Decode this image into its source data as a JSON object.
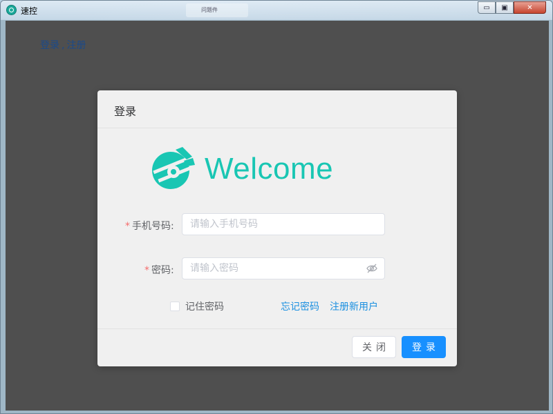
{
  "window": {
    "title": "速控",
    "background_tab_label": "问题件",
    "controls": {
      "minimize": "▭",
      "maximize": "▣",
      "close": "✕"
    }
  },
  "top_links": {
    "login": "登录",
    "separator": ",",
    "register": "注册"
  },
  "dialog": {
    "title": "登录",
    "welcome_text": "Welcome",
    "phone": {
      "label": "手机号码:",
      "placeholder": "请输入手机号码",
      "value": ""
    },
    "password": {
      "label": "密码:",
      "placeholder": "请输入密码",
      "value": ""
    },
    "required_mark": "*",
    "remember_label": "记住密码",
    "remember_checked": false,
    "forgot_link": "忘记密码",
    "register_link": "注册新用户",
    "close_button": "关闭",
    "login_button": "登录"
  },
  "colors": {
    "accent_teal": "#19c6b3",
    "primary_blue": "#1890ff",
    "link_blue": "#1a8fe0",
    "required_red": "#f56c6c",
    "overlay": "#4f4f4f"
  },
  "icons": {
    "app": "app-logo-icon",
    "brand": "brand-logo-icon",
    "password_toggle": "eye-hidden-icon"
  }
}
